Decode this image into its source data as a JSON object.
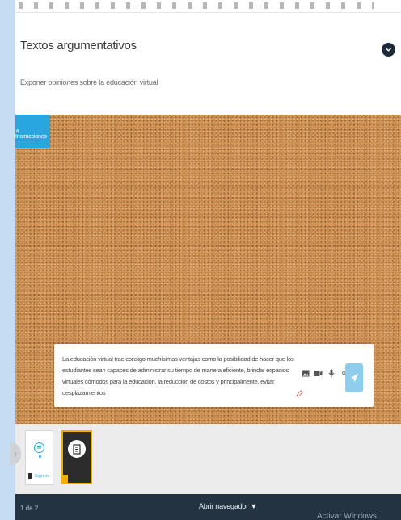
{
  "header": {
    "title": "Textos argumentativos",
    "subtitle": "Exponer opiniones sobre la educación virtual"
  },
  "board": {
    "instructions_tab": "∧ Instrucciones",
    "post": {
      "text": "La educación virtual trae consigo muchísimas ventajas como la posibilidad de hacer que los estudiantes sean capaces de administrar su tiempo de manera eficiente, brindar espacios virtuales cómodos para la educación, la reducción de costos y principalmente, evitar desplazamientos",
      "tools": [
        "image-icon",
        "video-icon",
        "microphone-icon"
      ],
      "gif_label": "GIF"
    }
  },
  "thumbnails": [
    {
      "label": "Sign in"
    },
    {
      "label": ""
    }
  ],
  "footer": {
    "page_indicator": "1 de 2",
    "open_browser": "Abrir navegador ▼",
    "activate_windows": "Activar Windows"
  },
  "colors": {
    "accent": "#2aa6df",
    "footer": "#233341",
    "cork": "#c98b4d",
    "thumbnail_border": "#f0b000"
  }
}
